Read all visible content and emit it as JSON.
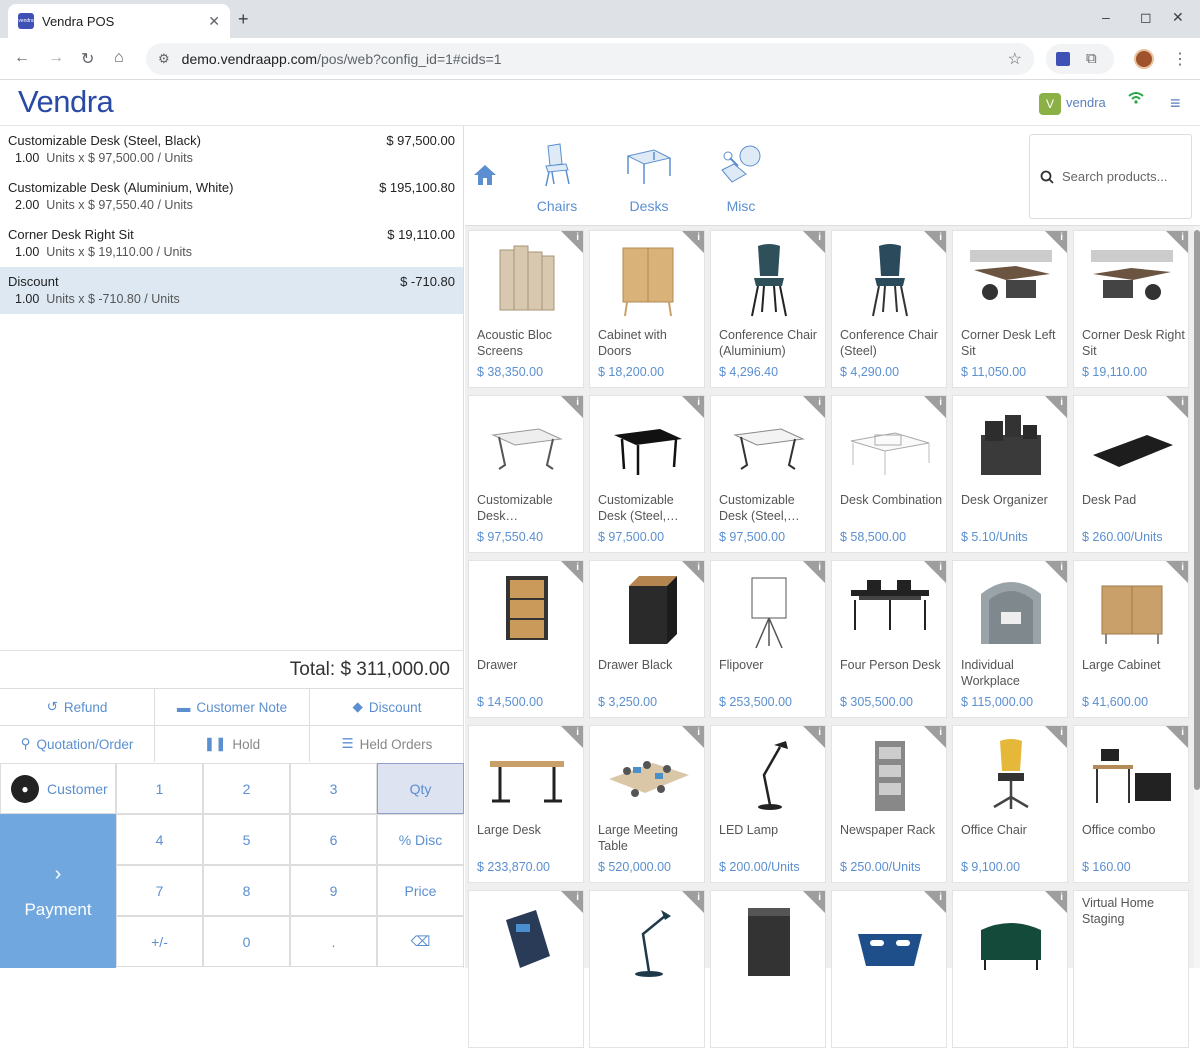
{
  "browser": {
    "tab_title": "Vendra POS",
    "url_host": "demo.vendraapp.com",
    "url_path": "/pos/web?config_id=1#cids=1"
  },
  "header": {
    "brand": "Vendra",
    "user_initial": "V",
    "user_name": "vendra"
  },
  "order": {
    "lines": [
      {
        "name": "Customizable Desk (Steel, Black)",
        "price": "$ 97,500.00",
        "qty": "1.00",
        "info": "Units x $ 97,500.00 / Units"
      },
      {
        "name": "Customizable Desk (Aluminium, White)",
        "price": "$ 195,100.80",
        "qty": "2.00",
        "info": "Units x $ 97,550.40 / Units"
      },
      {
        "name": "Corner Desk Right Sit",
        "price": "$ 19,110.00",
        "qty": "1.00",
        "info": "Units x $ 19,110.00 / Units"
      },
      {
        "name": "Discount",
        "price": "$ -710.80",
        "qty": "1.00",
        "info": "Units x $ -710.80 / Units"
      }
    ],
    "total": "Total: $ 311,000.00"
  },
  "controls": {
    "refund": "Refund",
    "customer_note": "Customer Note",
    "discount": "Discount",
    "quotation": "Quotation/Order",
    "hold": "Hold",
    "held_orders": "Held Orders"
  },
  "numpad": {
    "customer": "Customer",
    "payment": "Payment",
    "keys": [
      "1",
      "2",
      "3",
      "Qty",
      "4",
      "5",
      "6",
      "% Disc",
      "7",
      "8",
      "9",
      "Price",
      "+/-",
      "0",
      ".",
      "⌫"
    ]
  },
  "categories": [
    "Chairs",
    "Desks",
    "Misc"
  ],
  "search": {
    "placeholder": "Search products..."
  },
  "products": [
    {
      "name": "Acoustic Bloc Screens",
      "price": "$ 38,350.00"
    },
    {
      "name": "Cabinet with Doors",
      "price": "$ 18,200.00"
    },
    {
      "name": "Conference Chair (Aluminium)",
      "price": "$ 4,296.40"
    },
    {
      "name": "Conference Chair (Steel)",
      "price": "$ 4,290.00"
    },
    {
      "name": "Corner Desk Left Sit",
      "price": "$ 11,050.00"
    },
    {
      "name": "Corner Desk Right Sit",
      "price": "$ 19,110.00"
    },
    {
      "name": "Customizable Desk…",
      "price": "$ 97,550.40"
    },
    {
      "name": "Customizable Desk (Steel,…",
      "price": "$ 97,500.00"
    },
    {
      "name": "Customizable Desk (Steel,…",
      "price": "$ 97,500.00"
    },
    {
      "name": "Desk Combination",
      "price": "$ 58,500.00"
    },
    {
      "name": "Desk Organizer",
      "price": "$ 5.10/Units"
    },
    {
      "name": "Desk Pad",
      "price": "$ 260.00/Units"
    },
    {
      "name": "Drawer",
      "price": "$ 14,500.00"
    },
    {
      "name": "Drawer Black",
      "price": "$ 3,250.00"
    },
    {
      "name": "Flipover",
      "price": "$ 253,500.00"
    },
    {
      "name": "Four Person Desk",
      "price": "$ 305,500.00"
    },
    {
      "name": "Individual Workplace",
      "price": "$ 115,000.00"
    },
    {
      "name": "Large Cabinet",
      "price": "$ 41,600.00"
    },
    {
      "name": "Large Desk",
      "price": "$ 233,870.00"
    },
    {
      "name": "Large Meeting Table",
      "price": "$ 520,000.00"
    },
    {
      "name": "LED Lamp",
      "price": "$ 200.00/Units"
    },
    {
      "name": "Newspaper Rack",
      "price": "$ 250.00/Units"
    },
    {
      "name": "Office Chair",
      "price": "$ 9,100.00"
    },
    {
      "name": "Office combo",
      "price": "$ 160.00"
    },
    {
      "name": "",
      "price": ""
    },
    {
      "name": "",
      "price": ""
    },
    {
      "name": "",
      "price": ""
    },
    {
      "name": "",
      "price": ""
    },
    {
      "name": "",
      "price": ""
    },
    {
      "name": "Virtual Home Staging",
      "price": ""
    }
  ],
  "colors": {
    "accent": "#5b8fd0",
    "payment": "#6fa7de",
    "brand": "#2a4aa6",
    "selected_line": "#dde8f3"
  }
}
